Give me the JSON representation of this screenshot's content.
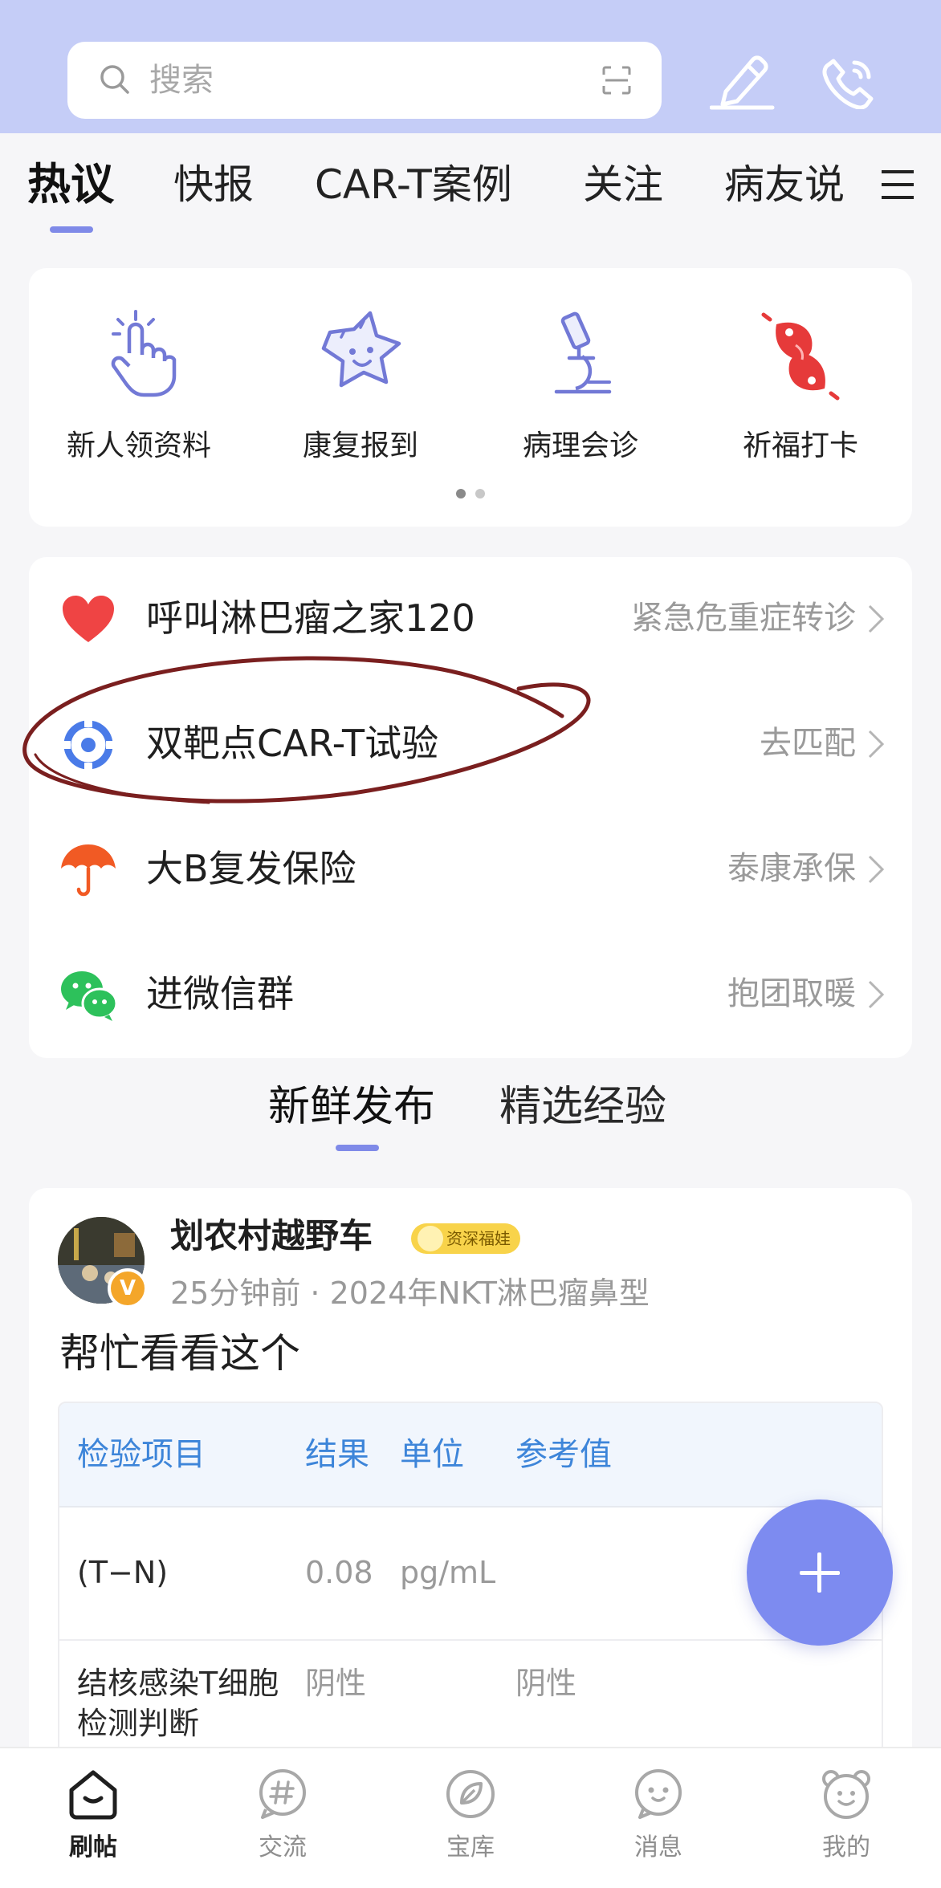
{
  "search": {
    "placeholder": "搜索",
    "scan_icon": "scan-icon"
  },
  "header_icons": [
    "pen-icon",
    "phone-icon"
  ],
  "tabs": [
    {
      "label": "热议",
      "active": true
    },
    {
      "label": "快报",
      "active": false
    },
    {
      "label": "CAR-T案例",
      "active": false
    },
    {
      "label": "关注",
      "active": false
    },
    {
      "label": "病友说",
      "active": false
    }
  ],
  "quick_actions": [
    {
      "label": "新人领资料",
      "icon": "tap-hand-icon"
    },
    {
      "label": "康复报到",
      "icon": "star-face-icon"
    },
    {
      "label": "病理会诊",
      "icon": "microscope-icon"
    },
    {
      "label": "祈福打卡",
      "icon": "koi-fish-icon"
    }
  ],
  "quick_pager": {
    "pages": 2,
    "current": 1
  },
  "links": [
    {
      "title": "呼叫淋巴瘤之家120",
      "right": "紧急危重症转诊",
      "icon": "heart-icon"
    },
    {
      "title": "双靶点CAR-T试验",
      "right": "去匹配",
      "icon": "target-icon"
    },
    {
      "title": "大B复发保险",
      "right": "泰康承保",
      "icon": "umbrella-icon"
    },
    {
      "title": "进微信群",
      "right": "抱团取暖",
      "icon": "wechat-icon"
    }
  ],
  "feed_tabs": [
    {
      "label": "新鲜发布",
      "active": true
    },
    {
      "label": "精选经验",
      "active": false
    }
  ],
  "post": {
    "author": "划农村越野车",
    "rank": "资深福娃",
    "verified_badge": "V",
    "meta": "25分钟前 · 2024年NKT淋巴瘤鼻型",
    "text": "帮忙看看这个",
    "table": {
      "headers": [
        "检验项目",
        "结果",
        "单位",
        "参考值"
      ],
      "rows": [
        [
          "(T−N)",
          "0.08",
          "pg/mL",
          ""
        ],
        [
          "结核感染T细胞检测判断",
          "阴性",
          "",
          "阴性"
        ]
      ]
    }
  },
  "fab": {
    "icon": "plus-icon"
  },
  "bottom_nav": [
    {
      "label": "刷帖",
      "icon": "home-icon",
      "active": true
    },
    {
      "label": "交流",
      "icon": "hashtag-icon",
      "active": false
    },
    {
      "label": "宝库",
      "icon": "compass-leaf-icon",
      "active": false
    },
    {
      "label": "消息",
      "icon": "chat-face-icon",
      "active": false
    },
    {
      "label": "我的",
      "icon": "bear-face-icon",
      "active": false
    }
  ],
  "colors": {
    "header_bg": "#c5cdf7",
    "accent": "#7f8ae8",
    "table_header_text": "#3d85d9",
    "annotation_ink": "#7a1f1f"
  }
}
